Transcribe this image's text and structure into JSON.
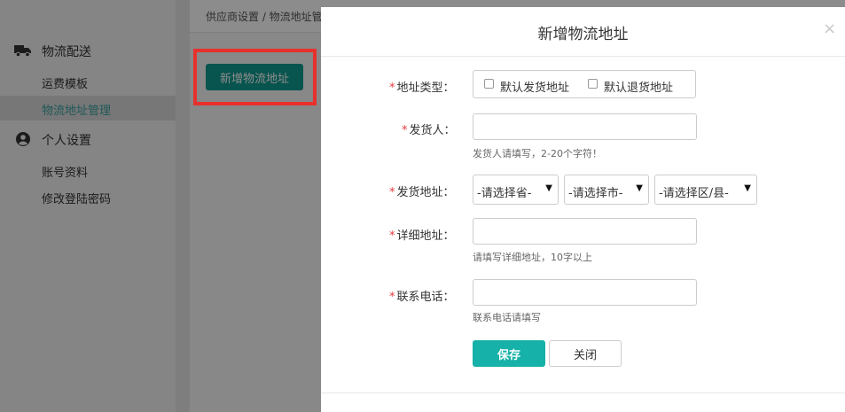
{
  "breadcrumb": "供应商设置 / 物流地址管",
  "sidebar": {
    "groups": [
      {
        "label": "物流配送",
        "icon": "truck-icon",
        "items": [
          {
            "label": "运费模板"
          },
          {
            "label": "物流地址管理",
            "active": true
          }
        ]
      },
      {
        "label": "个人设置",
        "icon": "user-circle-icon",
        "items": [
          {
            "label": "账号资料"
          },
          {
            "label": "修改登陆密码"
          }
        ]
      }
    ]
  },
  "main": {
    "add_button_label": "新增物流地址"
  },
  "annotation": {
    "color": "#e8302c"
  },
  "modal": {
    "title": "新增物流地址",
    "close_symbol": "×",
    "fields": {
      "address_type": {
        "label": "地址类型：",
        "options": [
          "默认发货地址",
          "默认退货地址"
        ],
        "checked": [
          false,
          false
        ]
      },
      "shipper": {
        "label": "发货人：",
        "value": "",
        "hint": "发货人请填写，2-20个字符！"
      },
      "ship_address": {
        "label": "发货地址：",
        "province": "-请选择省-",
        "city": "-请选择市-",
        "district": "-请选择区/县-"
      },
      "detail_address": {
        "label": "详细地址：",
        "value": "",
        "hint": "请填写详细地址，10字以上"
      },
      "phone": {
        "label": "联系电话：",
        "value": "",
        "hint": "联系电话请填写"
      }
    },
    "buttons": {
      "save": "保存",
      "close": "关闭"
    }
  },
  "colors": {
    "primary": "#16b1a8",
    "required": "#e4393c",
    "highlight": "#e8302c"
  }
}
